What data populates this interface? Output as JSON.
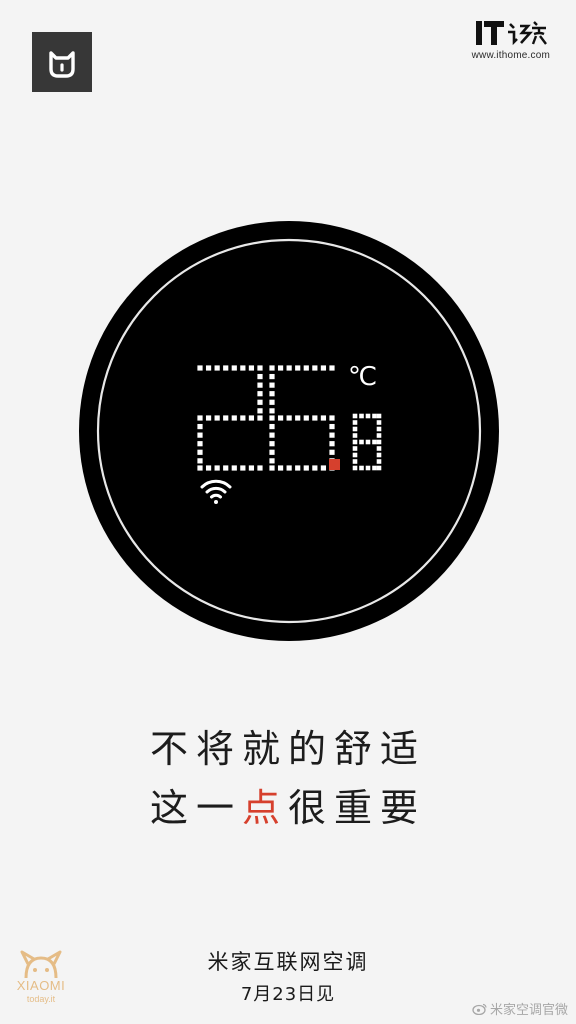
{
  "branding": {
    "logo_icon": "mijia-logo-icon",
    "watermark_text": "IT之家",
    "watermark_url": "www.ithome.com",
    "xiaomi_watermark": "XIAOMI",
    "xiaomi_watermark_sub": "today.it"
  },
  "device_display": {
    "temperature_integer": "26",
    "temperature_decimal": "8",
    "unit": "℃",
    "wifi_icon": "wifi-icon",
    "accent_color": "#d6402d"
  },
  "slogan": {
    "line1": "不将就的舒适",
    "line2_before": "这一",
    "line2_accent": "点",
    "line2_after": "很重要"
  },
  "footer": {
    "product_name": "米家互联网空调",
    "launch_date": "7月23日见",
    "weibo_credit": "米家空调官微"
  }
}
